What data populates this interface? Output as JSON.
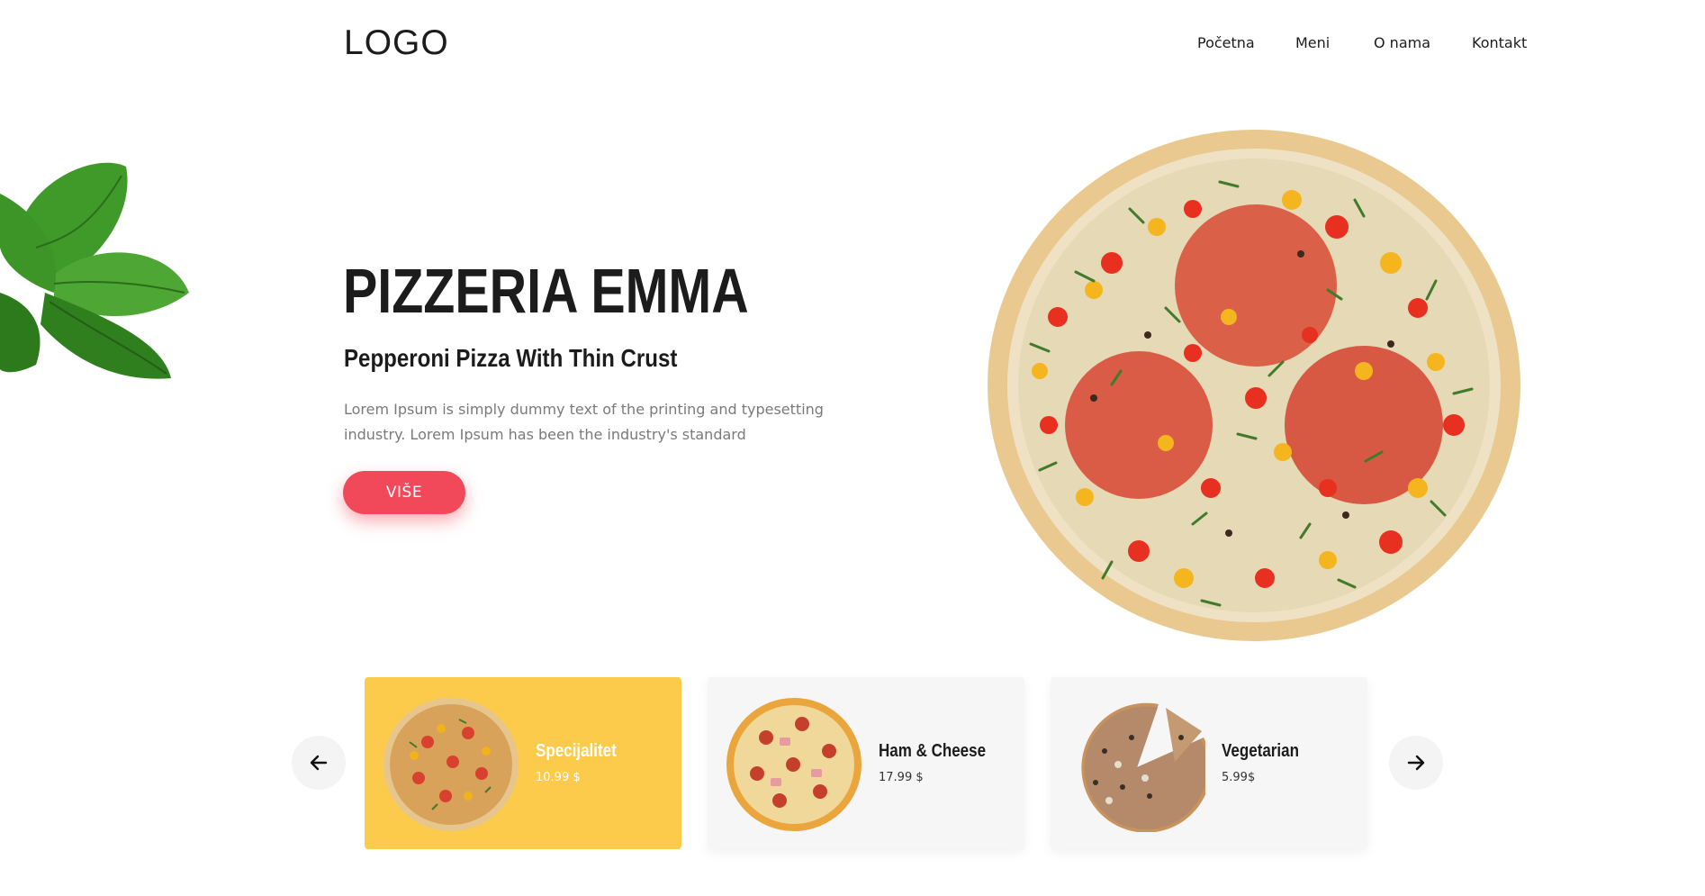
{
  "header": {
    "logo": "LOGO",
    "nav": [
      "Početna",
      "Meni",
      "O nama",
      "Kontakt"
    ]
  },
  "hero": {
    "title": "PIZZERIA EMMA",
    "subtitle": "Pepperoni Pizza With Thin Crust",
    "description": "Lorem Ipsum is simply dummy text of the printing and typesetting industry. Lorem Ipsum has been the industry's standard",
    "button_label": "VIŠE"
  },
  "slider": {
    "cards": [
      {
        "name": "Specijalitet",
        "price": "10.99 $",
        "active": true
      },
      {
        "name": "Ham & Cheese",
        "price": "17.99 $",
        "active": false
      },
      {
        "name": "Vegetarian",
        "price": "5.99$",
        "active": false
      }
    ]
  },
  "colors": {
    "accent": "#f1495a",
    "active_card": "#fccb4c",
    "card_bg": "#f6f6f6",
    "text_dark": "#1c1c1c",
    "text_muted": "#7a7a7a"
  },
  "icons": {
    "prev": "arrow-left-icon",
    "next": "arrow-right-icon"
  }
}
